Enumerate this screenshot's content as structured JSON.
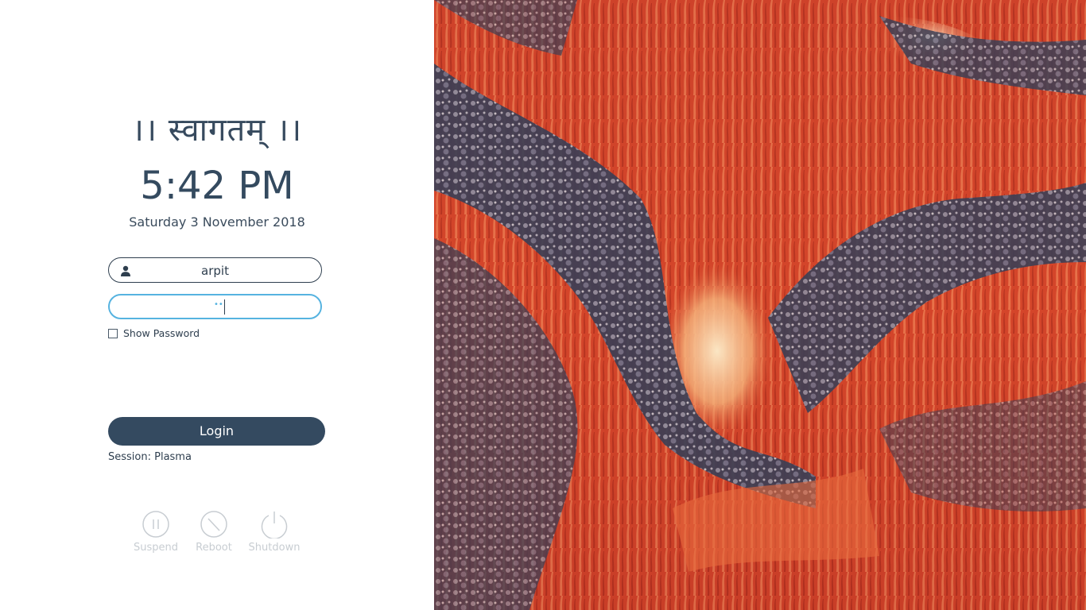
{
  "greeting": "।। स्वागतम् ।।",
  "clock": "5:42 PM",
  "date": "Saturday 3 November 2018",
  "login_form": {
    "username": "arpit",
    "password_masked": "••",
    "show_password_label": "Show Password",
    "login_label": "Login",
    "session_label": "Session: Plasma"
  },
  "power_actions": {
    "suspend": "Suspend",
    "reboot": "Reboot",
    "shutdown": "Shutdown"
  },
  "colors": {
    "accent": "#56b3e0",
    "button": "#344a60",
    "text": "#2e3e4e",
    "muted": "#c8cdd2"
  },
  "icons": [
    "user-icon",
    "suspend-icon",
    "reboot-icon",
    "shutdown-icon"
  ]
}
